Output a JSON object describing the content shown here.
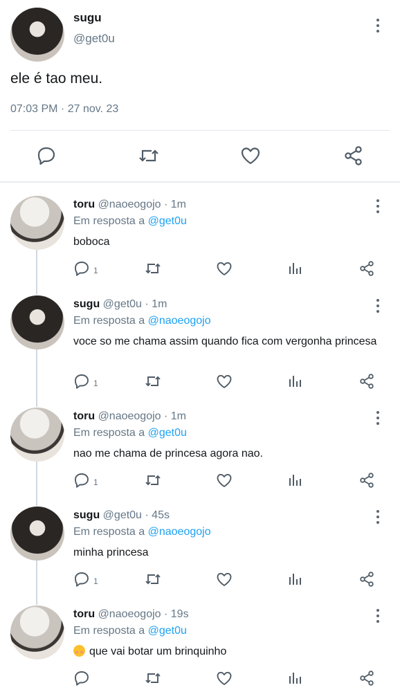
{
  "main_tweet": {
    "name": "sugu",
    "handle": "@get0u",
    "text": "ele é tao meu.",
    "timestamp": "07:03 PM · 27 nov. 23",
    "actions": [
      "reply-icon",
      "retweet-icon",
      "like-icon",
      "share-icon"
    ]
  },
  "replies": [
    {
      "name": "toru",
      "meta": "@naoeogojo · 1m",
      "in_reply_label": "Em resposta a",
      "in_reply_to": "@get0u",
      "text": "boboca",
      "reply_count": "1"
    },
    {
      "name": "sugu",
      "meta": "@get0u · 1m",
      "in_reply_label": "Em resposta a",
      "in_reply_to": "@naoeogojo",
      "text": "voce so me chama assim quando fica com vergonha princesa",
      "reply_count": "1"
    },
    {
      "name": "toru",
      "meta": "@naoeogojo · 1m",
      "in_reply_label": "Em resposta a",
      "in_reply_to": "@get0u",
      "text": "nao me chama de princesa agora nao.",
      "reply_count": "1"
    },
    {
      "name": "sugu",
      "meta": "@get0u · 45s",
      "in_reply_label": "Em resposta a",
      "in_reply_to": "@naoeogojo",
      "text": "minha princesa",
      "reply_count": "1"
    },
    {
      "name": "toru",
      "meta": "@naoeogojo · 19s",
      "in_reply_label": "Em resposta a",
      "in_reply_to": "@get0u",
      "text": "que vai botar um brinquinho",
      "reply_count": ""
    }
  ],
  "colors": {
    "link": "#1da1f2",
    "secondary_text": "#657786",
    "icon": "#4f5b66"
  }
}
